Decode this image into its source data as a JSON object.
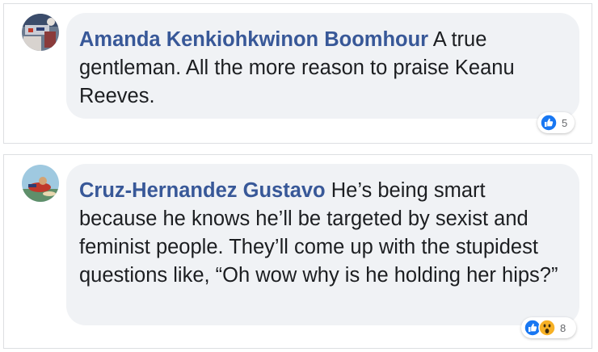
{
  "comments": [
    {
      "author": "Amanda Kenkiohkwinon Boomhour",
      "text": "A true gentleman. All the more reason to praise Keanu Reeves.",
      "reaction_count": "5",
      "reactions": [
        "like-icon"
      ]
    },
    {
      "author": "Cruz-Hernandez Gustavo",
      "text": "He’s being smart because he knows he’ll be targeted by sexist and feminist people. They’ll come up with the stupidest questions like, “Oh wow why is he holding her hips?”",
      "reaction_count": "8",
      "reactions": [
        "like-icon",
        "wow-icon"
      ]
    }
  ],
  "colors": {
    "author": "#385898",
    "bubble": "#f0f2f5",
    "like": "#1877f2",
    "wow": "#f7b125"
  }
}
